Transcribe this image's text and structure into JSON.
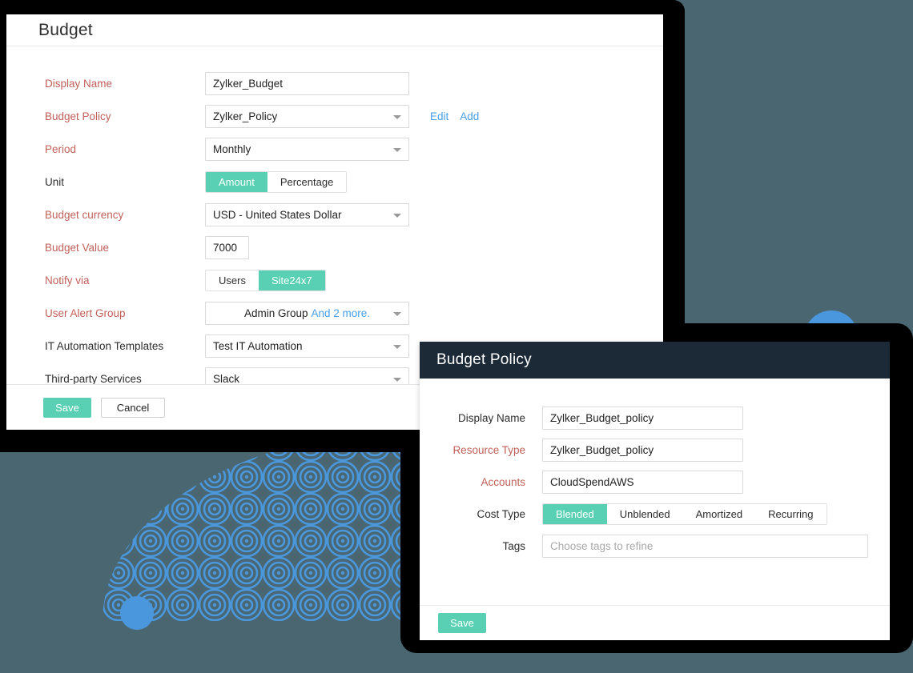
{
  "theme": {
    "background": "#4a6671",
    "accent_teal": "#59d0b3",
    "label_red": "#c1605a",
    "link_blue": "#4a9fe8",
    "dialog_header": "#1c2a38",
    "decor_blue": "#4a97dd"
  },
  "budget_card": {
    "title": "Budget",
    "fields": [
      {
        "label": "Display Name",
        "label_style": "red",
        "control": "text",
        "value": "Zylker_Budget",
        "width": "w255"
      },
      {
        "label": "Budget Policy",
        "label_style": "red",
        "control": "select",
        "value": "Zylker_Policy",
        "links": [
          "Edit",
          "Add"
        ]
      },
      {
        "label": "Period",
        "label_style": "red",
        "control": "select",
        "value": "Monthly"
      },
      {
        "label": "Unit",
        "label_style": "dark",
        "control": "segment",
        "options": [
          "Amount",
          "Percentage"
        ],
        "selected": "Amount"
      },
      {
        "label": "Budget currency",
        "label_style": "red",
        "control": "select",
        "value": "USD - United States Dollar"
      },
      {
        "label": "Budget Value",
        "label_style": "red",
        "control": "text",
        "value": "7000",
        "width": "w55"
      },
      {
        "label": "Notify via",
        "label_style": "red",
        "control": "segment",
        "options": [
          "Users",
          "Site24x7"
        ],
        "selected": "Site24x7"
      },
      {
        "label": "User Alert Group",
        "label_style": "red",
        "control": "select",
        "value": "Admin Group",
        "suffix": "And 2 more.",
        "centered": true
      },
      {
        "label": "IT Automation Templates",
        "label_style": "dark",
        "control": "select",
        "value": "Test IT Automation"
      },
      {
        "label": "Third-party Services",
        "label_style": "dark",
        "control": "select",
        "value": "Slack"
      }
    ],
    "footer": {
      "save_label": "Save",
      "cancel_label": "Cancel"
    }
  },
  "policy_dialog": {
    "title": "Budget Policy",
    "fields": [
      {
        "label": "Display Name",
        "label_style": "dark",
        "control": "text",
        "value": "Zylker_Budget_policy",
        "width": "w251"
      },
      {
        "label": "Resource Type",
        "label_style": "red",
        "control": "text",
        "value": "Zylker_Budget_policy",
        "width": "w251"
      },
      {
        "label": "Accounts",
        "label_style": "red",
        "control": "text",
        "value": "CloudSpendAWS",
        "width": "w251"
      },
      {
        "label": "Cost Type",
        "label_style": "dark",
        "control": "segment",
        "options": [
          "Blended",
          "Unblended",
          "Amortized",
          "Recurring"
        ],
        "selected": "Blended"
      },
      {
        "label": "Tags",
        "label_style": "dark",
        "control": "text",
        "value": "",
        "placeholder": "Choose tags to refine",
        "width": "w407"
      }
    ],
    "footer": {
      "save_label": "Save"
    }
  },
  "decoration": {
    "pattern_name": "concentric-circles-quarter",
    "dots": [
      "large-blue-dot",
      "small-blue-dot"
    ]
  }
}
